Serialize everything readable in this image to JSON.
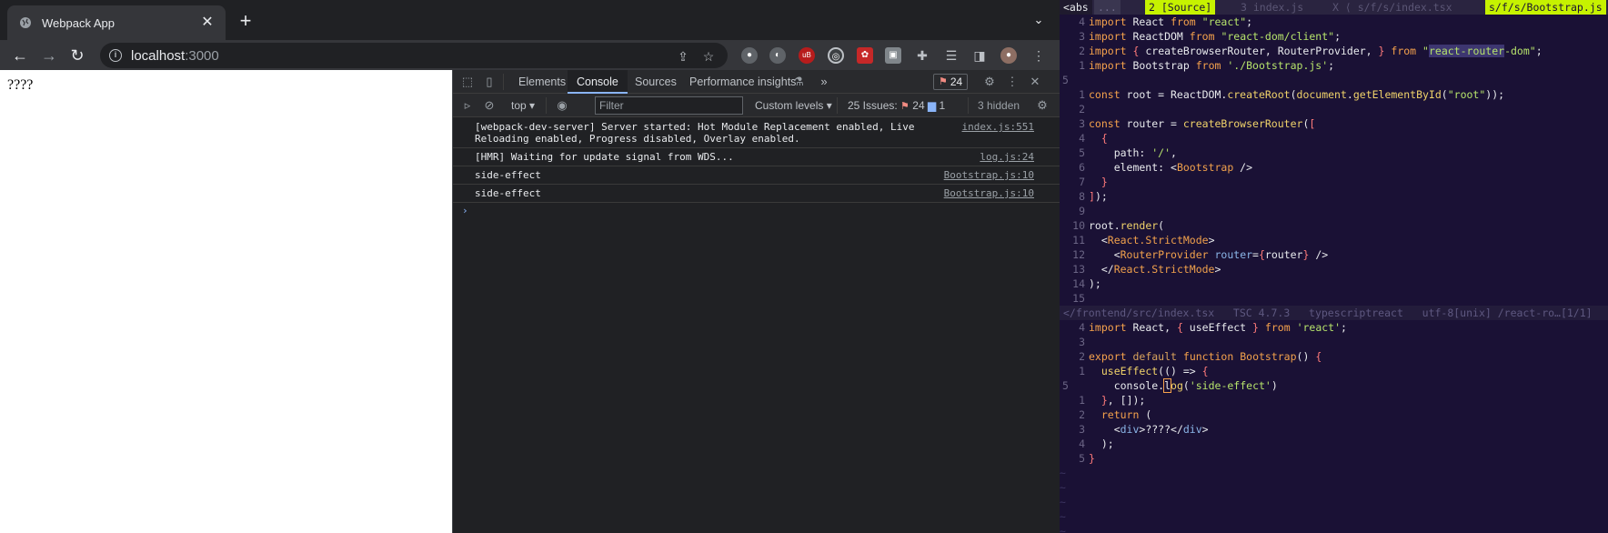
{
  "browser": {
    "tab_title": "Webpack App",
    "url_host": "localhost",
    "url_port": ":3000"
  },
  "page": {
    "text": "????"
  },
  "devtools": {
    "tabs": [
      "Elements",
      "Console",
      "Sources",
      "Performance insights"
    ],
    "active_tab": "Console",
    "overflow": "»",
    "issues_count": "24",
    "context": "top",
    "filter_placeholder": "Filter",
    "levels": "Custom levels",
    "issues_label": "25 Issues:",
    "issues_errors": "24",
    "issues_info": "1",
    "hidden": "3 hidden",
    "messages": [
      {
        "text": "[webpack-dev-server] Server started: Hot Module Replacement enabled, Live\nReloading enabled, Progress disabled, Overlay enabled.",
        "source": "index.js:551"
      },
      {
        "text": "[HMR] Waiting for update signal from WDS...",
        "source": "log.js:24"
      },
      {
        "text": "side-effect",
        "source": "Bootstrap.js:10"
      },
      {
        "text": "side-effect",
        "source": "Bootstrap.js:10"
      }
    ],
    "prompt": "›"
  },
  "editor": {
    "tabline": {
      "abs": "<abs",
      "dots": "...",
      "t2": "2  [Source]",
      "t3": "3  index.js",
      "tx": "X ⟨ s/f/s/index.tsx",
      "right": "s/f/s/Bootstrap.js"
    },
    "top_numbers": [
      "4",
      "3",
      "2",
      "1",
      "5",
      "1",
      "2",
      "3",
      "4",
      "5",
      "6",
      "7",
      "8",
      "9",
      "10",
      "11",
      "12",
      "13",
      "14",
      "15"
    ],
    "status": "</frontend/src/index.tsx   TSC 4.7.3   typescriptreact   utf-8[unix] /react-ro…[1/1]",
    "bottom_numbers": [
      "4",
      "3",
      "2",
      "1",
      "5",
      "1",
      "2",
      "3",
      "4",
      "5"
    ]
  }
}
